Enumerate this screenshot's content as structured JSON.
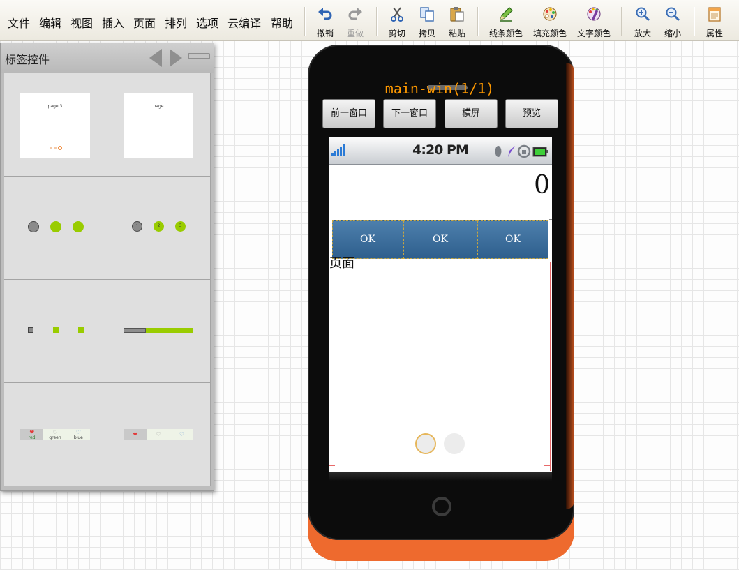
{
  "menu": [
    "文件",
    "编辑",
    "视图",
    "插入",
    "页面",
    "排列",
    "选项",
    "云编译",
    "帮助"
  ],
  "toolbar": {
    "undo": "撤销",
    "redo": "重做",
    "cut": "剪切",
    "copy": "拷贝",
    "paste": "粘贴",
    "line_color": "线条颜色",
    "fill_color": "填充颜色",
    "text_color": "文字颜色",
    "zoom_in": "放大",
    "zoom_out": "缩小",
    "properties": "属性"
  },
  "panel": {
    "title": "标签控件",
    "thumbs": {
      "page_a": "page 3",
      "page_b": "page",
      "step_numbers": [
        "1",
        "2",
        "3"
      ],
      "tab_labels": [
        "red",
        "green",
        "blue"
      ]
    }
  },
  "phone": {
    "window_title": "main-win(1/1)",
    "nav_buttons": [
      "前一窗口",
      "下一窗口",
      "横屏",
      "预览"
    ],
    "status_time": "4:20 PM",
    "counter": "0",
    "ok_buttons": [
      "OK",
      "OK",
      "OK"
    ],
    "page_label": "页面",
    "page_dots": 2,
    "active_page_dot": 1
  },
  "colors": {
    "accent_green": "#99cc00",
    "ok_button_blue": "#3b6c99",
    "phone_orange": "#ee6a2e",
    "title_orange": "#ff9900",
    "selection_red": "#e86a6a"
  }
}
